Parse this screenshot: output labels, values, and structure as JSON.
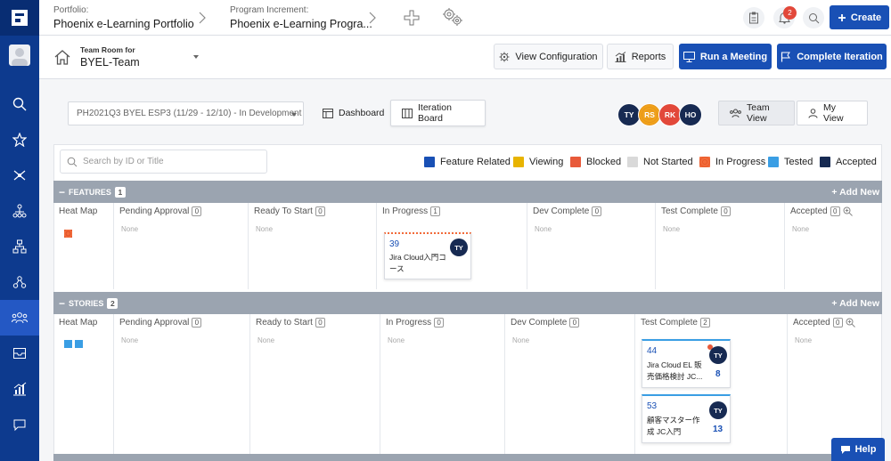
{
  "breadcrumb": {
    "portfolio_label": "Portfolio:",
    "portfolio_name": "Phoenix e-Learning Portfolio",
    "pi_label": "Program Increment:",
    "pi_name": "Phoenix e-Learning Progra..."
  },
  "topbar": {
    "create_label": "Create",
    "notification_count": "2"
  },
  "team": {
    "room_label": "Team Room for",
    "team_name": "BYEL-Team"
  },
  "toolbar": {
    "view_configuration": "View Configuration",
    "reports": "Reports",
    "run_meeting": "Run a Meeting",
    "complete_iteration": "Complete Iteration"
  },
  "iteration": {
    "selected": "PH2021Q3 BYEL ESP3 (11/29 - 12/10) - In Development",
    "dashboard_tab": "Dashboard",
    "iteration_board_tab": "Iteration Board"
  },
  "members": [
    {
      "initials": "TY",
      "color": "#172a52"
    },
    {
      "initials": "RS",
      "color": "#f0a21a"
    },
    {
      "initials": "RK",
      "color": "#e2483a"
    },
    {
      "initials": "HO",
      "color": "#172a52"
    }
  ],
  "views": {
    "team_view": "Team View",
    "my_view": "My View"
  },
  "search": {
    "placeholder": "Search by ID or Title",
    "value": ""
  },
  "legend": [
    {
      "label": "Feature Related",
      "color": "#1950b5"
    },
    {
      "label": "Viewing",
      "color": "#e8b400"
    },
    {
      "label": "Blocked",
      "color": "#e85a3a"
    },
    {
      "label": "Not Started",
      "color": "#d9d9d9"
    },
    {
      "label": "In Progress",
      "color": "#f26b3a"
    },
    {
      "label": "Tested",
      "color": "#3a9ee4"
    },
    {
      "label": "Accepted",
      "color": "#172a52"
    }
  ],
  "features": {
    "title": "FEATURES",
    "count": "1",
    "add_new": "+ Add New",
    "heatmap_label": "Heat Map",
    "columns": [
      {
        "name": "Pending Approval",
        "count": "0",
        "empty": "None"
      },
      {
        "name": "Ready To Start",
        "count": "0",
        "empty": "None"
      },
      {
        "name": "In Progress",
        "count": "1",
        "empty": ""
      },
      {
        "name": "Dev Complete",
        "count": "0",
        "empty": "None"
      },
      {
        "name": "Test Complete",
        "count": "0",
        "empty": "None"
      },
      {
        "name": "Accepted",
        "count": "0",
        "empty": "None"
      }
    ],
    "cards": [
      {
        "id": "39",
        "title_line1": "Jira Cloud入門コ",
        "title_line2": "ース",
        "assignee": "TY"
      }
    ]
  },
  "stories": {
    "title": "STORIES",
    "count": "2",
    "add_new": "+ Add New",
    "heatmap_label": "Heat Map",
    "columns": [
      {
        "name": "Pending Approval",
        "count": "0",
        "empty": "None"
      },
      {
        "name": "Ready to Start",
        "count": "0",
        "empty": "None"
      },
      {
        "name": "In Progress",
        "count": "0",
        "empty": "None"
      },
      {
        "name": "Dev Complete",
        "count": "0",
        "empty": "None"
      },
      {
        "name": "Test Complete",
        "count": "2",
        "empty": ""
      },
      {
        "name": "Accepted",
        "count": "0",
        "empty": "None"
      }
    ],
    "cards": [
      {
        "id": "44",
        "title_line1": "Jira Cloud EL 販",
        "title_line2": "売価格検討 JC...",
        "assignee": "TY",
        "points": "8"
      },
      {
        "id": "53",
        "title_line1": "顧客マスター作",
        "title_line2": "成 JC入門",
        "assignee": "TY",
        "points": "13"
      }
    ]
  },
  "help": {
    "label": "Help"
  }
}
